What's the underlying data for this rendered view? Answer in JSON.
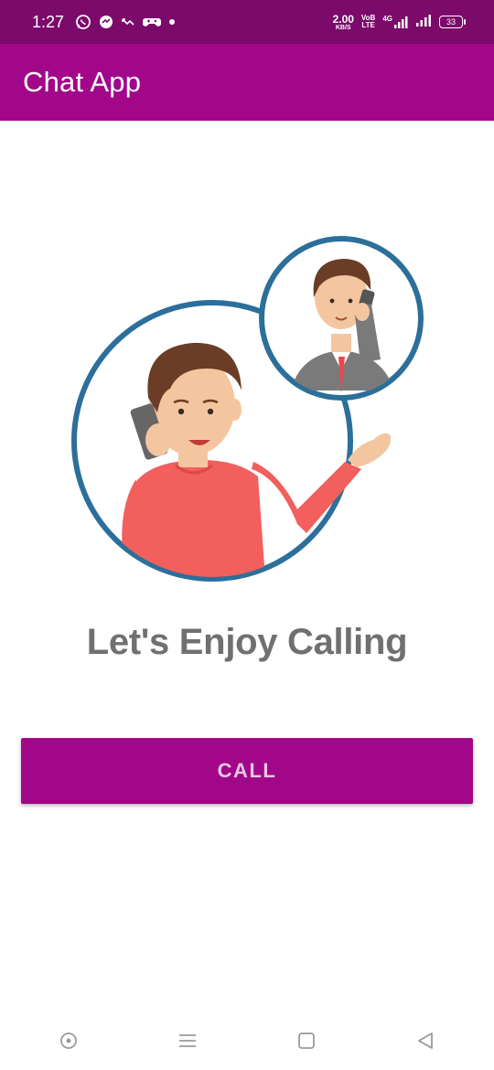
{
  "status_bar": {
    "time": "1:27",
    "net_speed_value": "2.00",
    "net_speed_unit": "KB/S",
    "volte_top": "VoB",
    "volte_bottom": "LTE",
    "network_type": "4G",
    "battery_level": "33",
    "left_icons": [
      "whatsapp-icon",
      "messenger-icon",
      "missed-call-icon",
      "gamepad-icon",
      "notification-dot-icon"
    ]
  },
  "app_bar": {
    "title": "Chat App"
  },
  "main": {
    "tagline": "Let's Enjoy Calling",
    "call_button_label": "CALL"
  },
  "nav_bar": {
    "items": [
      "assistant-icon",
      "recents-menu-icon",
      "home-icon",
      "back-icon"
    ]
  },
  "colors": {
    "status_bar": "#7b0a6b",
    "primary": "#a2078a",
    "tagline_text": "#707070",
    "circle_stroke": "#2b6f9a"
  }
}
